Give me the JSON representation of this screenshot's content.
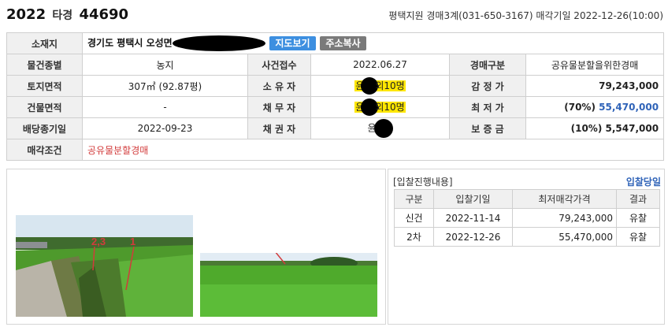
{
  "header": {
    "year": "2022",
    "case_type": "타경",
    "case_number": "44690",
    "court_info": "평택지원 경매3계(031-650-3167) 매각기일 2022-12-26(10:00)"
  },
  "property": {
    "location_label": "소재지",
    "location_value": "경기도 평택시 오성면",
    "map_button": "지도보기",
    "copy_button": "주소복사",
    "rows": {
      "type_label": "물건종별",
      "type_value": "농지",
      "filed_label": "사건접수",
      "filed_value": "2022.06.27",
      "auction_type_label": "경매구분",
      "auction_type_value": "공유물분할을위한경매",
      "land_area_label": "토지면적",
      "land_area_value": "307㎡ (92.87평)",
      "owner_label": "소 유 자",
      "owner_prefix": "윤",
      "owner_suffix": "외10명",
      "appraisal_label": "감 정 가",
      "appraisal_value": "79,243,000",
      "building_area_label": "건물면적",
      "building_area_value": "-",
      "debtor_label": "채 무 자",
      "debtor_prefix": "윤",
      "debtor_suffix": "외10명",
      "min_price_label": "최 저 가",
      "min_price_pct": "(70%)",
      "min_price_value": "55,470,000",
      "dividend_label": "배당종기일",
      "dividend_value": "2022-09-23",
      "creditor_label": "채 권 자",
      "creditor_prefix": "윤",
      "deposit_label": "보 증 금",
      "deposit_value": "(10%) 5,547,000",
      "sale_cond_label": "매각조건",
      "sale_cond_value": "공유물분할경매"
    }
  },
  "photos": {
    "annotation_left": "2,3",
    "annotation_right": "1"
  },
  "bidding": {
    "title": "[입찰진행내용]",
    "link": "입찰당일",
    "headers": [
      "구분",
      "입찰기일",
      "최저매각가격",
      "결과"
    ],
    "rows": [
      [
        "신건",
        "2022-11-14",
        "79,243,000",
        "유찰"
      ],
      [
        "2차",
        "2022-12-26",
        "55,470,000",
        "유찰"
      ]
    ]
  },
  "colors": {
    "accent_blue": "#2f63b8",
    "alert_red": "#d23b3b",
    "highlight_yellow": "#ffe700",
    "label_bg": "#f0f0f0"
  }
}
